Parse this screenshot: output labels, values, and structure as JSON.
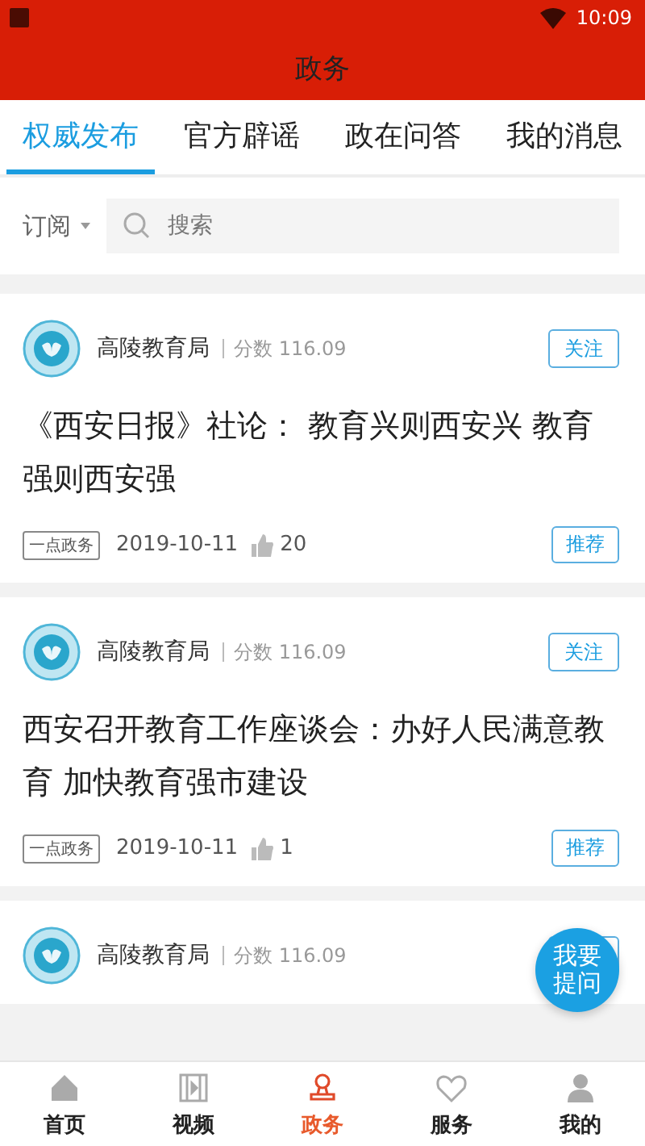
{
  "status_bar": {
    "time": "10:09"
  },
  "header": {
    "title": "政务"
  },
  "tabs": [
    {
      "label": "权威发布",
      "selected": true
    },
    {
      "label": "官方辟谣",
      "selected": false
    },
    {
      "label": "政在问答",
      "selected": false
    },
    {
      "label": "我的消息",
      "selected": false
    }
  ],
  "filter": {
    "label": "订阅"
  },
  "search": {
    "placeholder": "搜索"
  },
  "posts": [
    {
      "author": "高陵教育局",
      "score": "分数 116.09",
      "follow": "关注",
      "title": "《西安日报》社论： 教育兴则西安兴 教育强则西安强",
      "source": "一点政务",
      "date": "2019-10-11",
      "likes": "20",
      "tag": "推荐"
    },
    {
      "author": "高陵教育局",
      "score": "分数 116.09",
      "follow": "关注",
      "title": "西安召开教育工作座谈会：办好人民满意教育 加快教育强市建设",
      "source": "一点政务",
      "date": "2019-10-11",
      "likes": "1",
      "tag": "推荐"
    },
    {
      "author": "高陵教育局",
      "score": "分数 116.09"
    }
  ],
  "ask_button": {
    "label": "我要提问"
  },
  "nav": [
    {
      "label": "首页",
      "kind": "home",
      "selected": false
    },
    {
      "label": "视频",
      "kind": "video",
      "selected": false
    },
    {
      "label": "政务",
      "kind": "stamp",
      "selected": true
    },
    {
      "label": "服务",
      "kind": "heart",
      "selected": false
    },
    {
      "label": "我的",
      "kind": "user",
      "selected": false
    }
  ]
}
